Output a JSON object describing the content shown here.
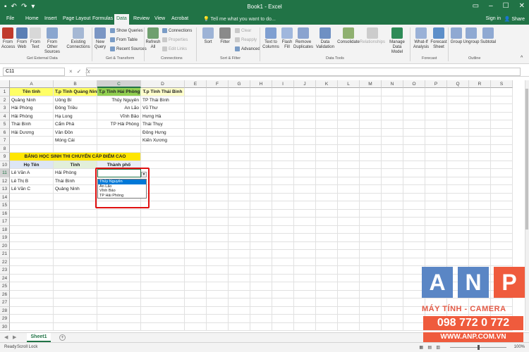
{
  "window": {
    "title": "Book1 - Excel",
    "signin": "Sign in",
    "share": "Share"
  },
  "tabs": [
    "File",
    "Home",
    "Insert",
    "Page Layout",
    "Formulas",
    "Data",
    "Review",
    "View",
    "Acrobat"
  ],
  "active_tab": "Data",
  "tellme": "Tell me what you want to do...",
  "ribbon": {
    "get_external": {
      "items": [
        "From Access",
        "From Web",
        "From Text",
        "From Other Sources",
        "Existing Connections"
      ],
      "label": "Get External Data"
    },
    "get_transform": {
      "new_query": "New Query",
      "show_queries": "Show Queries",
      "from_table": "From Table",
      "recent_sources": "Recent Sources",
      "label": "Get & Transform"
    },
    "connections": {
      "refresh_all": "Refresh All",
      "connections": "Connections",
      "properties": "Properties",
      "edit_links": "Edit Links",
      "label": "Connections"
    },
    "sort_filter": {
      "sort": "Sort",
      "filter": "Filter",
      "clear": "Clear",
      "reapply": "Reapply",
      "advanced": "Advanced",
      "label": "Sort & Filter"
    },
    "data_tools": {
      "items": [
        "Text to Columns",
        "Flash Fill",
        "Remove Duplicates",
        "Data Validation",
        "Consolidate",
        "Relationships",
        "Manage Data Model"
      ],
      "label": "Data Tools"
    },
    "forecast": {
      "items": [
        "What-If Analysis",
        "Forecast Sheet"
      ],
      "label": "Forecast"
    },
    "outline": {
      "items": [
        "Group",
        "Ungroup",
        "Subtotal"
      ],
      "label": "Outline"
    }
  },
  "formula_bar": {
    "name_box": "C11",
    "icons": [
      "×",
      "✓",
      "fx"
    ],
    "value": ""
  },
  "columns": [
    "A",
    "B",
    "C",
    "D",
    "E",
    "F",
    "G",
    "H",
    "I",
    "J",
    "K",
    "L",
    "M",
    "N",
    "O",
    "P",
    "Q",
    "R",
    "S"
  ],
  "rows": [
    "1",
    "2",
    "3",
    "4",
    "5",
    "6",
    "7",
    "8",
    "9",
    "10",
    "11",
    "12",
    "13",
    "14",
    "15",
    "16",
    "17",
    "18",
    "19",
    "20",
    "21",
    "22",
    "23",
    "24",
    "25",
    "26",
    "27",
    "28",
    "29",
    "30",
    "31"
  ],
  "sheet": {
    "headers_row1": [
      "Tên tỉnh",
      "T.p Tỉnh Quảng Ninh",
      "T.p Tỉnh Hải Phòng",
      "T.p Tỉnh Thái Bình"
    ],
    "col_a": [
      "Quảng Ninh",
      "Hải Phòng",
      "Hải Phòng",
      "Thái Bình",
      "Hải Dương"
    ],
    "col_b": [
      "Uông Bí",
      "Đông Triều",
      "Hạ Long",
      "Cẩm Phả",
      "Vân Đồn",
      "Móng Cái"
    ],
    "col_c": [
      "Thủy Nguyên",
      "An Lão",
      "Vĩnh Bảo",
      "TP Hải Phòng"
    ],
    "col_d": [
      "TP Thái Bình",
      "Vũ Thư",
      "Hưng Hà",
      "Thái Thụy",
      "Đông Hưng",
      "Kiến Xương"
    ],
    "table_title": "BẢNG HỌC SINH THI CHUYỂN CẤP ĐIỂM CAO",
    "table_headers": [
      "Họ Tên",
      "Tỉnh",
      "Thành phố"
    ],
    "students": [
      {
        "name": "Lê Văn A",
        "province": "Hải Phòng"
      },
      {
        "name": "Lê Thị B",
        "province": "Thái Bình"
      },
      {
        "name": "Lê Văn C",
        "province": "Quảng Ninh"
      }
    ]
  },
  "dropdown": {
    "items": [
      "Thủy Nguyên",
      "An Lão",
      "Vĩnh Bảo",
      "TP Hải Phòng"
    ],
    "highlighted": "Thủy Nguyên"
  },
  "sheet_tabs": [
    "Sheet1"
  ],
  "status": {
    "left": [
      "Ready",
      "Scroll Lock"
    ],
    "zoom": "100%"
  },
  "watermark": {
    "letters": [
      "A",
      "N",
      "P"
    ],
    "slogan": "MÁY TÍNH - CAMERA",
    "phone": "098 772 0 772",
    "website": "WWW.ANP.COM.VN"
  },
  "colors": {
    "excel_green": "#217346",
    "header_yellow": "#ffff66",
    "header_green": "#92d050",
    "dropdown_highlight": "#0078d7",
    "red_annotation": "#e01010",
    "brand_red": "#ef5b3d",
    "brand_blue": "#5a86c5"
  }
}
